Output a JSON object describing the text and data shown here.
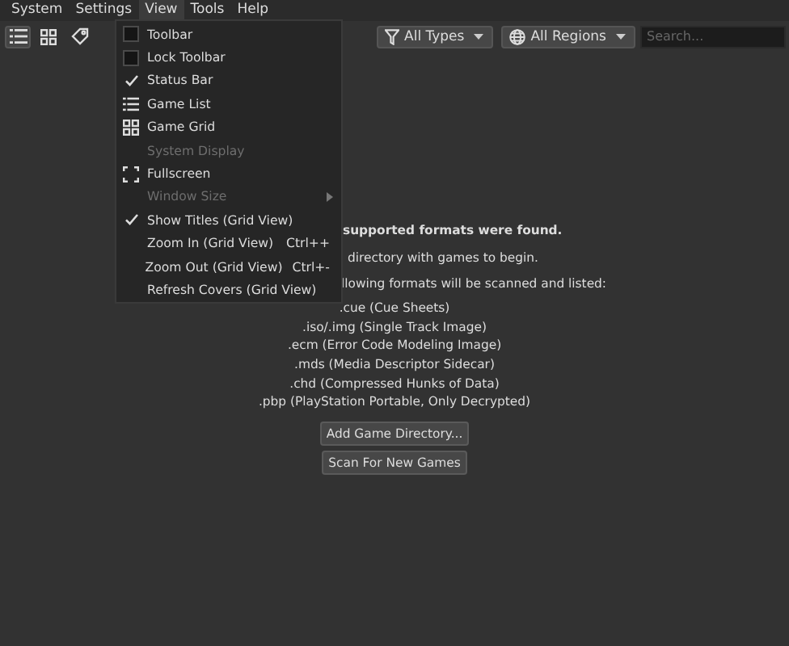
{
  "menubar": [
    {
      "label": "System",
      "selected": false
    },
    {
      "label": "Settings",
      "selected": false
    },
    {
      "label": "View",
      "selected": true
    },
    {
      "label": "Tools",
      "selected": false
    },
    {
      "label": "Help",
      "selected": false
    }
  ],
  "toolbar": {
    "buttons": [
      {
        "kind": "list",
        "selected": true
      },
      {
        "kind": "grid",
        "selected": false
      },
      {
        "kind": "tag",
        "selected": false
      }
    ],
    "type_filter": {
      "label": "All Types"
    },
    "region_filter": {
      "label": "All Regions"
    },
    "search": {
      "placeholder": "Search..."
    }
  },
  "view_menu": [
    {
      "kind": "check",
      "label": "Toolbar",
      "checked": false,
      "disabled": false
    },
    {
      "kind": "check",
      "label": "Lock Toolbar",
      "checked": false,
      "disabled": false
    },
    {
      "kind": "check",
      "label": "Status Bar",
      "checked": true,
      "disabled": false
    },
    {
      "kind": "list-icon",
      "label": "Game List",
      "disabled": false
    },
    {
      "kind": "grid-icon",
      "label": "Game Grid",
      "disabled": false
    },
    {
      "kind": "plain",
      "label": "System Display",
      "disabled": true
    },
    {
      "kind": "fullscreen-icon",
      "label": "Fullscreen",
      "disabled": false
    },
    {
      "kind": "submenu",
      "label": "Window Size",
      "disabled": true
    },
    {
      "kind": "check",
      "label": "Show Titles (Grid View)",
      "checked": true,
      "disabled": false
    },
    {
      "kind": "plain",
      "label": "Zoom In (Grid View)",
      "shortcut": "Ctrl++",
      "disabled": false
    },
    {
      "kind": "plain",
      "label": "Zoom Out (Grid View)",
      "shortcut": "Ctrl+-",
      "disabled": false
    },
    {
      "kind": "plain",
      "label": "Refresh Covers (Grid View)",
      "disabled": false
    }
  ],
  "empty_state": {
    "heading": "supported formats were found.",
    "hint": "directory with games to begin.",
    "formats_intro": "llowing formats will be scanned and listed:",
    "formats": [
      ".cue (Cue Sheets)",
      ".iso/.img (Single Track Image)",
      ".ecm (Error Code Modeling Image)",
      ".mds (Media Descriptor Sidecar)",
      ".chd (Compressed Hunks of Data)",
      ".pbp (PlayStation Portable, Only Decrypted)"
    ],
    "buttons": [
      "Add Game Directory...",
      "Scan For New Games"
    ]
  }
}
